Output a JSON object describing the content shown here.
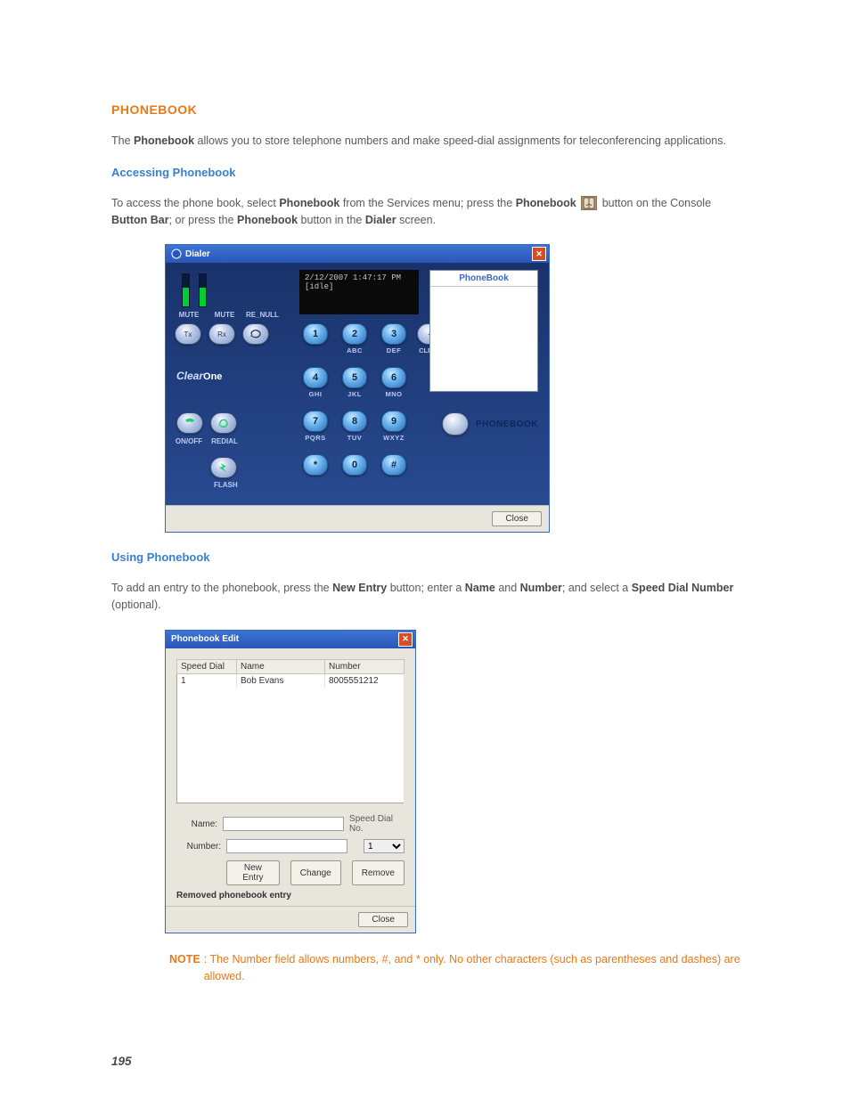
{
  "page_number": "195",
  "title": "PHONEBOOK",
  "intro_pre": "The ",
  "intro_bold": "Phonebook",
  "intro_post": " allows you to store telephone numbers and make speed-dial assignments for teleconferencing applications.",
  "sub1": "Accessing Phonebook",
  "access": {
    "pre": "To access the phone book, select ",
    "b1": "Phonebook",
    "mid1": " from the Services menu; press the ",
    "b2": "Phonebook",
    "mid2": " button on the Console ",
    "b3": "Button Bar",
    "mid3": "; or press the ",
    "b4": "Phonebook",
    "mid4": " button in the ",
    "b5": "Dialer",
    "post": " screen."
  },
  "dialer": {
    "title": "Dialer",
    "display_time": "2/12/2007 1:47:17 PM",
    "display_status": "[idle]",
    "mute1": "MUTE",
    "mute2": "MUTE",
    "renull": "RE_NULL",
    "btn_tx": "Tx",
    "btn_rx": "Rx",
    "brand_a": "Clear",
    "brand_b": "One",
    "onoff": "ON/OFF",
    "redial": "REDIAL",
    "flash": "FLASH",
    "keys": [
      {
        "d": "1",
        "l": ""
      },
      {
        "d": "2",
        "l": "ABC"
      },
      {
        "d": "3",
        "l": "DEF"
      },
      {
        "d": "4",
        "l": "GHI"
      },
      {
        "d": "5",
        "l": "JKL"
      },
      {
        "d": "6",
        "l": "MNO"
      },
      {
        "d": "7",
        "l": "PQRS"
      },
      {
        "d": "8",
        "l": "TUV"
      },
      {
        "d": "9",
        "l": "WXYZ"
      },
      {
        "d": "*",
        "l": ""
      },
      {
        "d": "0",
        "l": ""
      },
      {
        "d": "#",
        "l": ""
      }
    ],
    "clear_sym": "◄",
    "clear": "CLEAR",
    "pb_header": "PhoneBook",
    "pb_button": "PHONEBOOK",
    "close": "Close"
  },
  "sub2": "Using Phonebook",
  "using": {
    "pre": "To add an entry to the phonebook, press the ",
    "b1": "New Entry",
    "mid1": " button; enter a ",
    "b2": "Name",
    "mid2": " and ",
    "b3": "Number",
    "mid3": "; and select a ",
    "b4": "Speed Dial Number",
    "post": " (optional)."
  },
  "pbe": {
    "title": "Phonebook Edit",
    "col_sd": "Speed Dial",
    "col_name": "Name",
    "col_num": "Number",
    "row1": {
      "sd": "1",
      "name": "Bob Evans",
      "num": "8005551212"
    },
    "lbl_name": "Name:",
    "lbl_number": "Number:",
    "lbl_sd": "Speed Dial No.",
    "sd_value": "1",
    "btn_new": "New Entry",
    "btn_change": "Change",
    "btn_remove": "Remove",
    "status": "Removed phonebook entry",
    "close": "Close"
  },
  "note_label": "NOTE",
  "note_text": ": The Number field allows numbers, #, and * only. No other characters (such as parentheses and dashes) are allowed."
}
